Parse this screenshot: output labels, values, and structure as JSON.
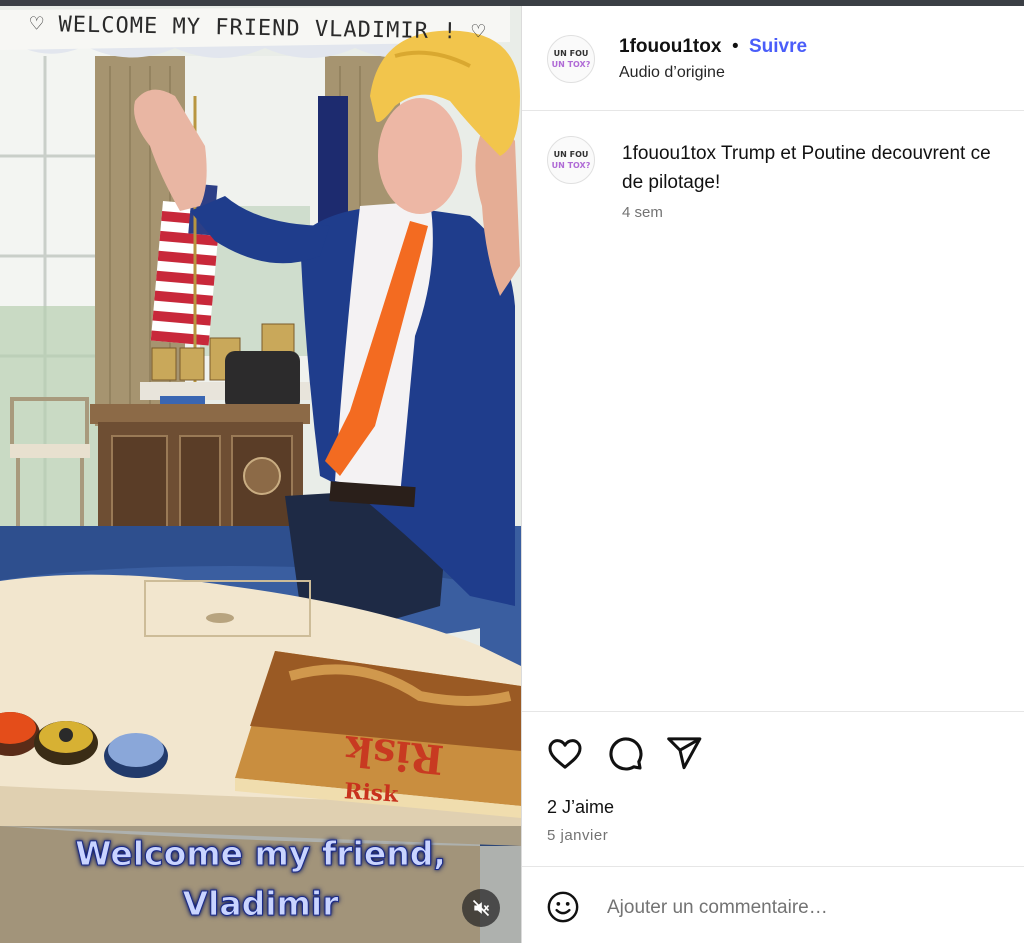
{
  "media": {
    "banner_text": "♡ WELCOME MY FRIEND VLADIMIR ! ♡",
    "subtitle_line1": "Welcome my friend,",
    "subtitle_line2": "Vladimir",
    "box_label": "Risk",
    "box_label_front": "Risk"
  },
  "header": {
    "avatar_line1": "UN FOU",
    "avatar_line2": "UN TOX?",
    "username": "1fouou1tox",
    "separator": "•",
    "follow_label": "Suivre",
    "audio": "Audio d’origine"
  },
  "caption": {
    "avatar_line1": "UN FOU",
    "avatar_line2": "UN TOX?",
    "username": "1fouou1tox",
    "text_line1": "Trump et Poutine decouvrent ce",
    "text_line2": "de pilotage!",
    "time": "4 sem"
  },
  "actions": {
    "like_icon": "heart-icon",
    "comment_icon": "comment-icon",
    "share_icon": "send-icon"
  },
  "stats": {
    "likes": "2 J’aime",
    "date": "5 janvier"
  },
  "comment": {
    "placeholder": "Ajouter un commentaire…"
  },
  "colors": {
    "follow": "#4a5df9",
    "muted": "#737373",
    "subtitle": "#c9d4ff"
  }
}
